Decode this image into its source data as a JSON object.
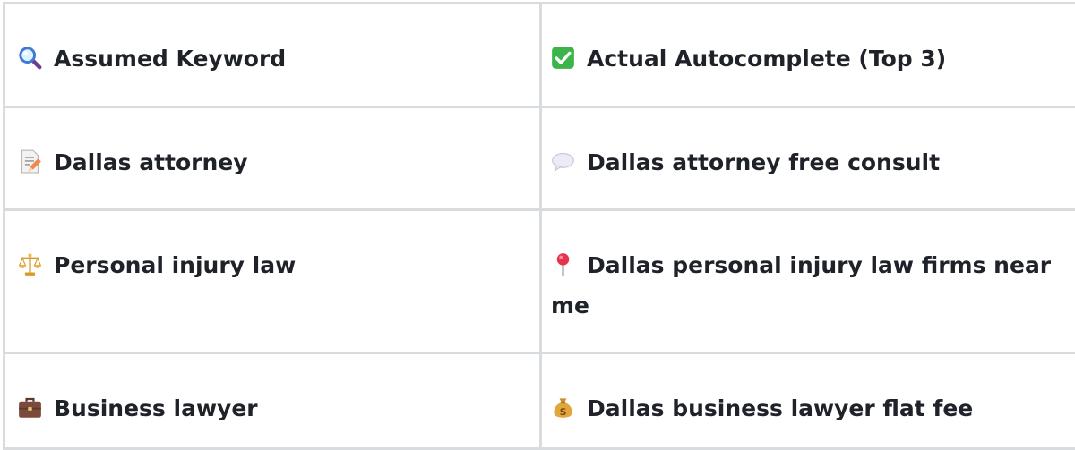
{
  "table": {
    "header": {
      "left": {
        "icon": "magnifying-glass-icon",
        "label": "Assumed Keyword"
      },
      "right": {
        "icon": "check-mark-icon",
        "label": "Actual Autocomplete (Top 3)"
      }
    },
    "rows": [
      {
        "left": {
          "icon": "memo-pencil-icon",
          "label": "Dallas attorney"
        },
        "right": {
          "icon": "speech-bubble-icon",
          "label": "Dallas attorney free consult"
        }
      },
      {
        "left": {
          "icon": "balance-scale-icon",
          "label": "Personal injury law"
        },
        "right": {
          "icon": "pushpin-icon",
          "label": "Dallas personal injury law firms near me"
        }
      },
      {
        "left": {
          "icon": "briefcase-icon",
          "label": "Business lawyer"
        },
        "right": {
          "icon": "money-bag-icon",
          "label": "Dallas business lawyer flat fee"
        }
      }
    ]
  },
  "colors": {
    "border": "#d9dcdf",
    "text": "#1f2329",
    "check_green": "#3bb54a"
  }
}
